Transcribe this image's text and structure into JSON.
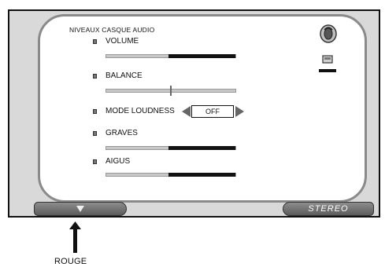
{
  "panel": {
    "title": "NIVEAUX CASQUE AUDIO",
    "icons": [
      "headphone-icon",
      "small-screen-icon"
    ]
  },
  "settings": {
    "volume": {
      "label": "VOLUME",
      "level": 0.48
    },
    "balance": {
      "label": "BALANCE",
      "level": 0.5
    },
    "mode_loudness": {
      "label": "MODE LOUDNESS",
      "value": "OFF"
    },
    "graves": {
      "label": "GRAVES",
      "level": 0.48
    },
    "aigus": {
      "label": "AIGUS",
      "level": 0.48
    }
  },
  "softkeys": {
    "left": {
      "icon": "down-arrow-icon"
    },
    "right": {
      "label": "STEREO"
    }
  },
  "callout": {
    "label": "ROUGE"
  },
  "colors": {
    "screen_bg": "#d9d9d9",
    "panel_bg": "#ffffff",
    "slider_fill": "#121212",
    "slider_track": "#c8c8c8",
    "softkey_bg": "#6f6f6f"
  }
}
